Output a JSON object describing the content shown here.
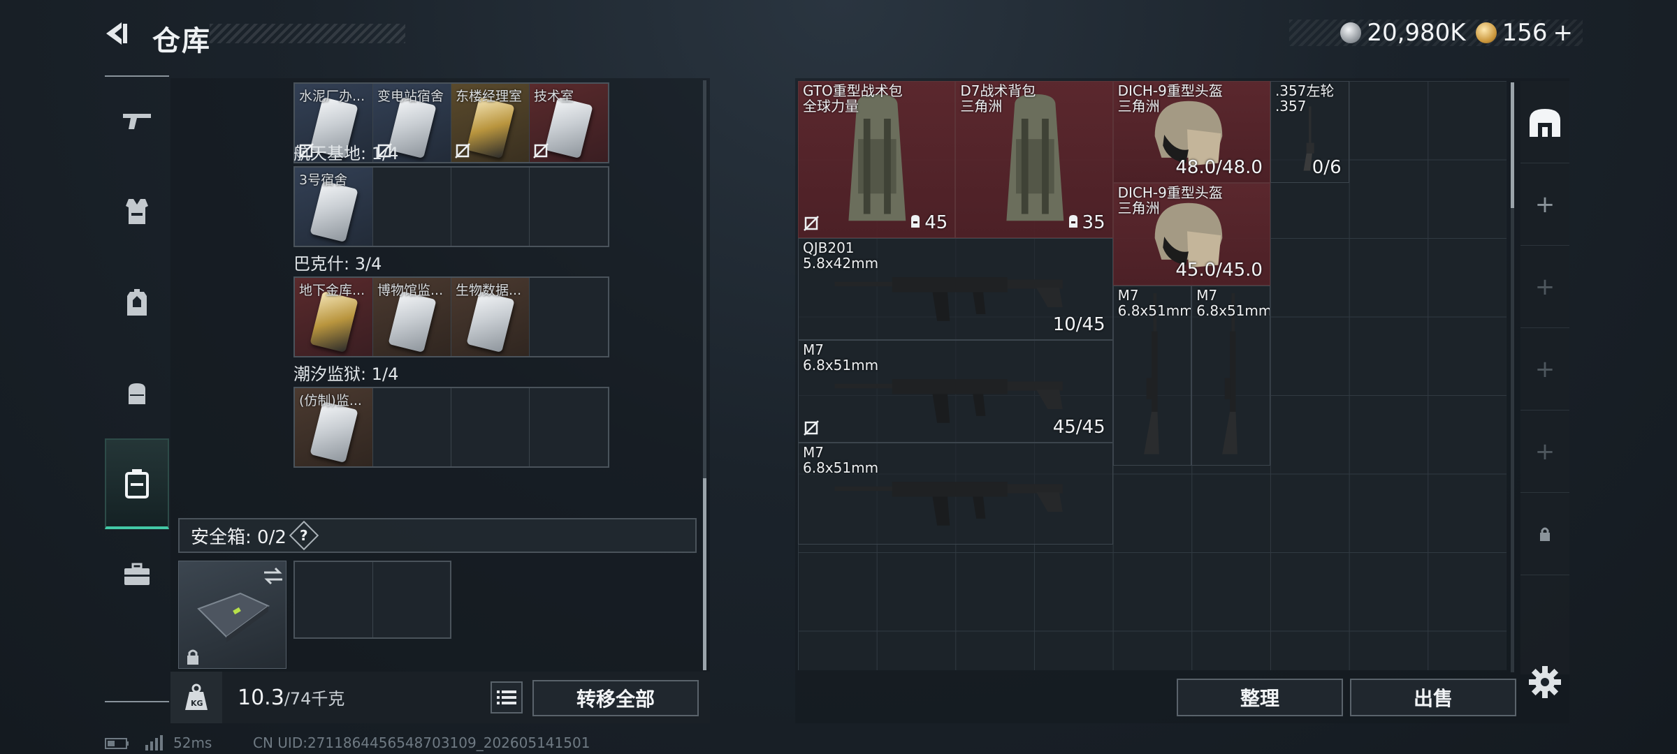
{
  "header": {
    "title": "仓库"
  },
  "currency": {
    "silver": "20,980K",
    "gold": "156",
    "gold_plus": "+"
  },
  "colors": {
    "accent": "#43c9a6",
    "red_item": "#5a2a2c"
  },
  "rail": {
    "items": [
      "gun-icon",
      "vest-icon",
      "backpack-icon",
      "bag-icon",
      "container-icon",
      "toolbox-icon"
    ],
    "active_index": 4
  },
  "left": {
    "groups": [
      {
        "label": "",
        "slots": [
          {
            "label": "水泥厂办...",
            "color": "blue"
          },
          {
            "label": "变电站宿舍",
            "color": "blue"
          },
          {
            "label": "东楼经理室",
            "color": "gold"
          },
          {
            "label": "技术室",
            "color": "red"
          }
        ]
      },
      {
        "label": "航天基地: 1/4",
        "slots": [
          {
            "label": "3号宿舍",
            "color": "blue"
          },
          {
            "label": ""
          },
          {
            "label": ""
          },
          {
            "label": ""
          }
        ]
      },
      {
        "label": "巴克什: 3/4",
        "slots": [
          {
            "label": "地下金库...",
            "color": "red"
          },
          {
            "label": "博物馆监...",
            "color": "brown"
          },
          {
            "label": "生物数据...",
            "color": "brown"
          },
          {
            "label": ""
          }
        ]
      },
      {
        "label": "潮汐监狱: 1/4",
        "slots": [
          {
            "label": "(仿制)监...",
            "color": "brown"
          },
          {
            "label": ""
          },
          {
            "label": ""
          },
          {
            "label": ""
          }
        ]
      }
    ],
    "safe_box": {
      "label": "安全箱: 0/2",
      "help": "?"
    },
    "weight": {
      "current": "10.3",
      "max": "/74千克"
    },
    "transfer_all": "转移全部"
  },
  "stash": {
    "items": [
      {
        "name": "GTO重型战术包",
        "sub": "全球力量",
        "value": "45",
        "kind": "backpack"
      },
      {
        "name": "D7战术背包",
        "sub": "三角洲",
        "value": "35",
        "kind": "backpack"
      },
      {
        "name": "DICH-9重型头盔",
        "sub": "三角洲",
        "value": "48.0/48.0",
        "kind": "helmet"
      },
      {
        "name": ".357左轮",
        "sub": ".357",
        "value": "0/6",
        "kind": "pistol"
      },
      {
        "name": "DICH-9重型头盔",
        "sub": "三角洲",
        "value": "45.0/45.0",
        "kind": "helmet"
      },
      {
        "name": "QJB201",
        "sub": "5.8x42mm",
        "value": "10/45",
        "kind": "rifle"
      },
      {
        "name": "M7",
        "sub": "6.8x51mm",
        "value": "",
        "kind": "rifle-v"
      },
      {
        "name": "M7",
        "sub": "6.8x51mm",
        "value": "",
        "kind": "rifle-v"
      },
      {
        "name": "M7",
        "sub": "6.8x51mm",
        "value": "45/45",
        "kind": "rifle"
      },
      {
        "name": "M7",
        "sub": "6.8x51mm",
        "value": "",
        "kind": "rifle"
      }
    ],
    "organize": "整理",
    "sell": "出售"
  },
  "status": {
    "ping": "52ms",
    "uid": "CN UID:2711864456548703109_202605141501"
  }
}
